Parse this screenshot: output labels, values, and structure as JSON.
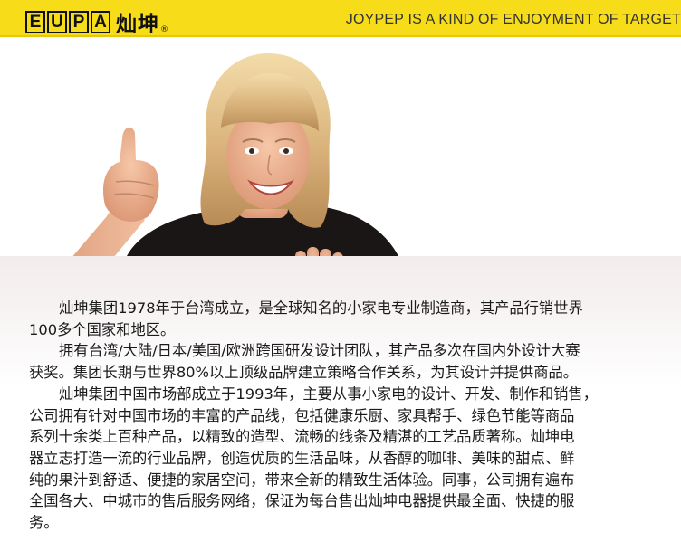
{
  "header": {
    "logo_letters": [
      "E",
      "U",
      "P",
      "A"
    ],
    "logo_chinese": "灿坤",
    "logo_reg": "®",
    "tagline": "JOYPEP IS A KIND OF ENJOYMENT OF TARGET",
    "colors": {
      "bar": "#f7dc1a",
      "text": "#111111"
    }
  },
  "photo": {
    "icon": "woman-thumbs-up-holding-board"
  },
  "body": {
    "lines": [
      "灿坤集团1978年于台湾成立，是全球知名的小家电专业制造商，其产品行销世界",
      "100多个国家和地区。",
      "拥有台湾/大陆/日本/美国/欧洲跨国研发设计团队，其产品多次在国内外设计大赛",
      "获奖。集团长期与世界80%以上顶级品牌建立策略合作关系，为其设计并提供商品。",
      "灿坤集团中国市场部成立于1993年，主要从事小家电的设计、开发、制作和销售，",
      "公司拥有针对中国市场的丰富的产品线，包括健康乐厨、家具帮手、绿色节能等商品",
      "系列十余类上百种产品，以精致的造型、流畅的线条及精湛的工艺品质著称。灿坤电",
      "器立志打造一流的行业品牌，创造优质的生活品味，从香醇的咖啡、美味的甜点、鲜",
      "纯的果汁到舒适、便捷的家居空间，带来全新的精致生活体验。同事，公司拥有遍布",
      "全国各大、中城市的售后服务网络，保证为每台售出灿坤电器提供最全面、快捷的服",
      "务。"
    ]
  }
}
